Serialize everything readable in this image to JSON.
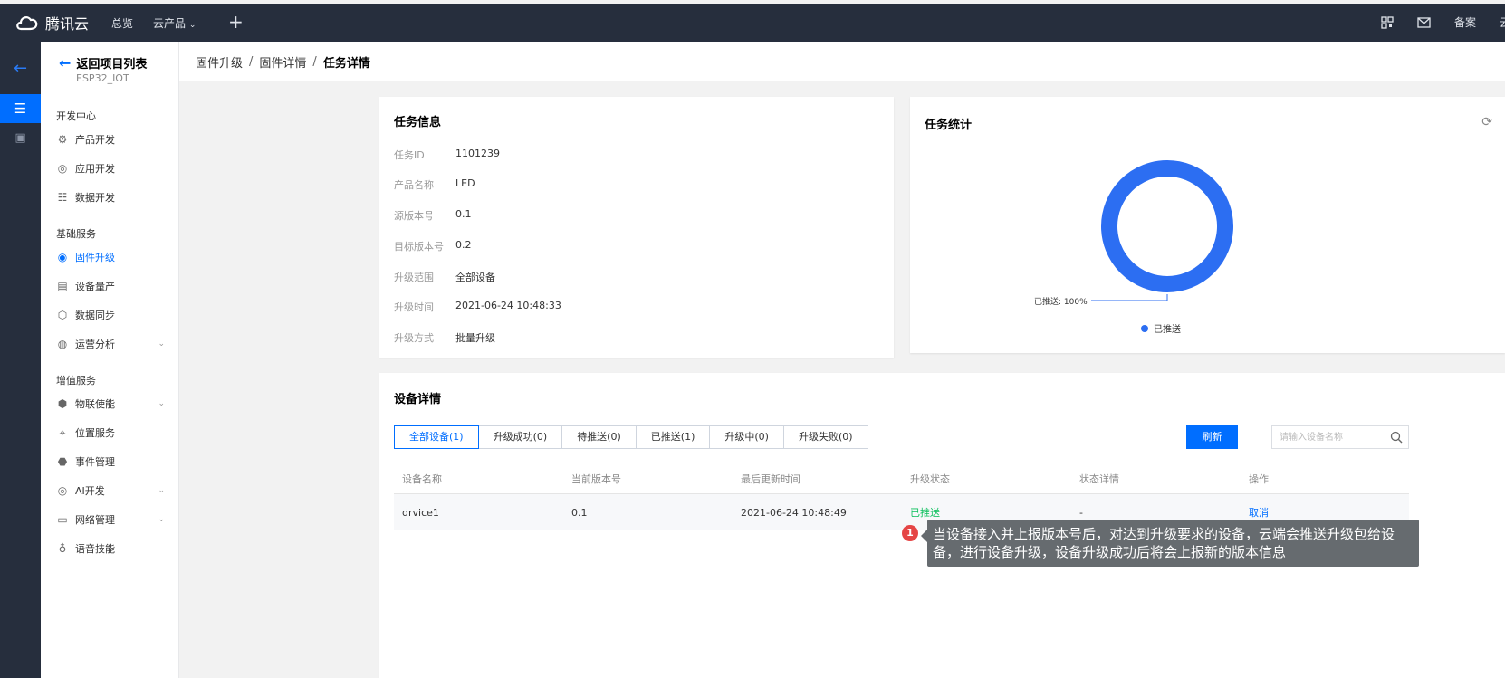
{
  "topbar": {
    "brand": "腾讯云",
    "nav": [
      "总览",
      "云产品"
    ],
    "right": [
      "备案",
      "云"
    ]
  },
  "sidemenu": {
    "back_label": "返回项目列表",
    "project": "ESP32_IOT",
    "groups": [
      {
        "title": "开发中心",
        "items": [
          "产品开发",
          "应用开发",
          "数据开发"
        ]
      },
      {
        "title": "基础服务",
        "items": [
          "固件升级",
          "设备量产",
          "数据同步",
          "运营分析"
        ]
      },
      {
        "title": "增值服务",
        "items": [
          "物联使能",
          "位置服务",
          "事件管理",
          "AI开发",
          "网络管理",
          "语音技能"
        ]
      }
    ]
  },
  "breadcrumb": [
    "固件升级",
    "固件详情",
    "任务详情"
  ],
  "task_info": {
    "title": "任务信息",
    "rows": [
      {
        "k": "任务ID",
        "v": "1101239"
      },
      {
        "k": "产品名称",
        "v": "LED"
      },
      {
        "k": "源版本号",
        "v": "0.1"
      },
      {
        "k": "目标版本号",
        "v": "0.2"
      },
      {
        "k": "升级范围",
        "v": "全部设备"
      },
      {
        "k": "升级时间",
        "v": "2021-06-24 10:48:33"
      },
      {
        "k": "升级方式",
        "v": "批量升级"
      }
    ]
  },
  "task_stats": {
    "title": "任务统计",
    "callout": "已推送: 100%",
    "legend": "已推送",
    "color": "#2c6ef2"
  },
  "chart_data": {
    "type": "pie",
    "categories": [
      "已推送"
    ],
    "values": [
      100
    ]
  },
  "device_detail": {
    "title": "设备详情",
    "tabs": [
      "全部设备(1)",
      "升级成功(0)",
      "待推送(0)",
      "已推送(1)",
      "升级中(0)",
      "升级失败(0)"
    ],
    "refresh_label": "刷新",
    "search_placeholder": "请输入设备名称",
    "columns": [
      "设备名称",
      "当前版本号",
      "最后更新时间",
      "升级状态",
      "状态详情",
      "操作"
    ],
    "rows": [
      [
        "drvice1",
        "0.1",
        "2021-06-24 10:48:49",
        "已推送",
        "-",
        "取消"
      ]
    ]
  },
  "tooltip": {
    "badge": "1",
    "text": "当设备接入并上报版本号后，对达到升级要求的设备，云端会推送升级包给设备，进行设备升级，设备升级成功后将会上报新的版本信息"
  }
}
